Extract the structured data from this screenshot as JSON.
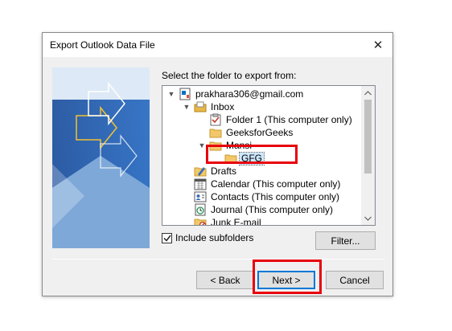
{
  "window": {
    "title": "Export Outlook Data File",
    "close_glyph": "✕"
  },
  "prompt": "Select the folder to export from:",
  "tree": {
    "items": [
      {
        "label": "prakhara306@gmail.com",
        "icon": "data-file-icon",
        "expanded": true
      },
      {
        "label": "Inbox",
        "icon": "inbox-icon",
        "expanded": true
      },
      {
        "label": "Folder 1 (This computer only)",
        "icon": "tasks-folder-icon"
      },
      {
        "label": "GeeksforGeeks",
        "icon": "folder-icon"
      },
      {
        "label": "Mansi",
        "icon": "folder-icon",
        "expanded": true
      },
      {
        "label": "GFG",
        "icon": "folder-icon",
        "selected": true
      },
      {
        "label": "Drafts",
        "icon": "drafts-icon"
      },
      {
        "label": "Calendar (This computer only)",
        "icon": "calendar-icon"
      },
      {
        "label": "Contacts (This computer only)",
        "icon": "contacts-icon"
      },
      {
        "label": "Journal (This computer only)",
        "icon": "journal-icon"
      },
      {
        "label": "Junk E-mail",
        "icon": "junk-icon"
      }
    ]
  },
  "include_subfolders": {
    "label": "Include subfolders",
    "checked": true
  },
  "buttons": {
    "filter": "Filter...",
    "back": "< Back",
    "next": "Next >",
    "cancel": "Cancel"
  },
  "colors": {
    "highlight_box": "#e8000b",
    "selection": "#cce8ff",
    "default_button_border": "#0078d7"
  }
}
